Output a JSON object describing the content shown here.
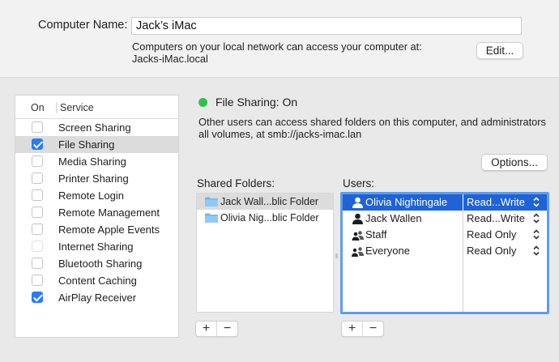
{
  "computer_name": {
    "label": "Computer Name:",
    "value": "Jack’s iMac",
    "description_line1": "Computers on your local network can access your computer at:",
    "description_line2": "Jacks-iMac.local",
    "edit_label": "Edit..."
  },
  "services": {
    "header_on": "On",
    "header_service": "Service",
    "items": [
      {
        "label": "Screen Sharing",
        "checked": false,
        "selected": false
      },
      {
        "label": "File Sharing",
        "checked": true,
        "selected": true
      },
      {
        "label": "Media Sharing",
        "checked": false,
        "selected": false
      },
      {
        "label": "Printer Sharing",
        "checked": false,
        "selected": false
      },
      {
        "label": "Remote Login",
        "checked": false,
        "selected": false
      },
      {
        "label": "Remote Management",
        "checked": false,
        "selected": false
      },
      {
        "label": "Remote Apple Events",
        "checked": false,
        "selected": false
      },
      {
        "label": "Internet Sharing",
        "checked": false,
        "selected": false,
        "disabled": true
      },
      {
        "label": "Bluetooth Sharing",
        "checked": false,
        "selected": false
      },
      {
        "label": "Content Caching",
        "checked": false,
        "selected": false
      },
      {
        "label": "AirPlay Receiver",
        "checked": true,
        "selected": false
      }
    ]
  },
  "status": {
    "text": "File Sharing: On",
    "color": "#2fc24a",
    "description_line1": "Other users can access shared folders on this computer, and administrators",
    "description_line2": "all volumes, at smb://jacks-imac.lan"
  },
  "options_label": "Options...",
  "shared_folders": {
    "label": "Shared Folders:",
    "items": [
      {
        "label": "Jack Wall...blic Folder",
        "selected": true
      },
      {
        "label": "Olivia Nig...blic Folder",
        "selected": false
      }
    ],
    "add": "+",
    "remove": "−"
  },
  "users": {
    "label": "Users:",
    "items": [
      {
        "name": "Olivia Nightingale",
        "permission": "Read...Write",
        "icon": "person-icon",
        "selected": true
      },
      {
        "name": "Jack Wallen",
        "permission": "Read...Write",
        "icon": "person-icon",
        "selected": false
      },
      {
        "name": "Staff",
        "permission": "Read Only",
        "icon": "group-icon",
        "selected": false
      },
      {
        "name": "Everyone",
        "permission": "Read Only",
        "icon": "group-icon",
        "selected": false
      }
    ],
    "add": "+",
    "remove": "−"
  },
  "colors": {
    "accent": "#1f63d6",
    "focus_ring": "#5e9cf0",
    "checkbox": "#2a7bf6"
  }
}
